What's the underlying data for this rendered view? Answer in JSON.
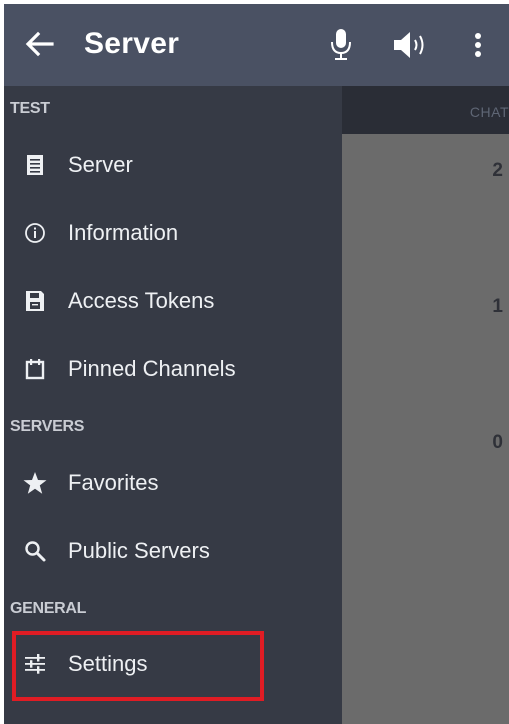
{
  "appbar": {
    "title": "Server",
    "icons": [
      "back-arrow-icon",
      "microphone-icon",
      "volume-icon",
      "more-vert-icon"
    ]
  },
  "main": {
    "column_header": "CHAT",
    "counts": [
      "2",
      "1",
      "0"
    ]
  },
  "drawer": {
    "sections": {
      "test": "TEST",
      "servers": "SERVERS",
      "general": "GENERAL"
    },
    "items": [
      {
        "label": "Server",
        "icon": "list-icon"
      },
      {
        "label": "Information",
        "icon": "info-icon"
      },
      {
        "label": "Access Tokens",
        "icon": "save-icon"
      },
      {
        "label": "Pinned Channels",
        "icon": "calendar-icon"
      },
      {
        "label": "Favorites",
        "icon": "star-icon"
      },
      {
        "label": "Public Servers",
        "icon": "search-icon"
      },
      {
        "label": "Settings",
        "icon": "sliders-icon"
      }
    ]
  },
  "colors": {
    "appbar": "#4a5163",
    "drawer": "#363a45",
    "highlight": "#e01c24"
  }
}
